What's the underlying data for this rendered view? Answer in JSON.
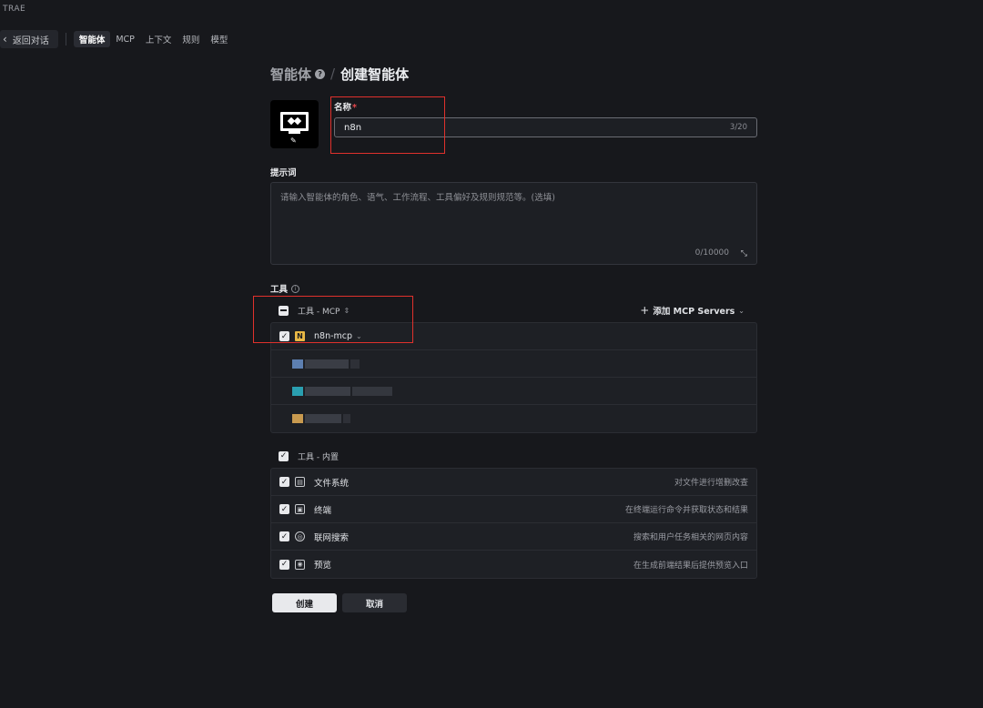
{
  "app": {
    "title": "TRAE"
  },
  "topnav": {
    "back_label": "返回对话",
    "tabs": [
      {
        "label": "智能体",
        "active": true
      },
      {
        "label": "MCP",
        "active": false
      },
      {
        "label": "上下文",
        "active": false
      },
      {
        "label": "规则",
        "active": false
      },
      {
        "label": "模型",
        "active": false
      }
    ]
  },
  "breadcrumb": {
    "parent": "智能体",
    "current": "创建智能体"
  },
  "name_field": {
    "label": "名称",
    "required_mark": "*",
    "value": "n8n",
    "counter": "3/20"
  },
  "prompt_field": {
    "label": "提示词",
    "placeholder": "请输入智能体的角色、语气、工作流程、工具偏好及规则规范等。(选填)",
    "counter": "0/10000"
  },
  "tools": {
    "label": "工具",
    "mcp_group": {
      "title": "工具 - MCP",
      "add_label": "添加 MCP Servers",
      "items": [
        {
          "name": "n8n-mcp",
          "badge": "N",
          "checked": true
        }
      ]
    },
    "builtin_group": {
      "title": "工具 - 内置",
      "items": [
        {
          "name": "文件系统",
          "desc": "对文件进行增删改查",
          "icon": "file-icon",
          "checked": true
        },
        {
          "name": "终端",
          "desc": "在终端运行命令并获取状态和结果",
          "icon": "terminal-icon",
          "checked": true
        },
        {
          "name": "联网搜索",
          "desc": "搜索和用户任务相关的网页内容",
          "icon": "globe-icon",
          "checked": true
        },
        {
          "name": "预览",
          "desc": "在生成前端结果后提供预览入口",
          "icon": "eye-icon",
          "checked": true
        }
      ]
    }
  },
  "actions": {
    "create_label": "创建",
    "cancel_label": "取消"
  },
  "colors": {
    "background": "#17181c",
    "highlight": "#e0312c",
    "mcp_badge": "#e9b845"
  }
}
